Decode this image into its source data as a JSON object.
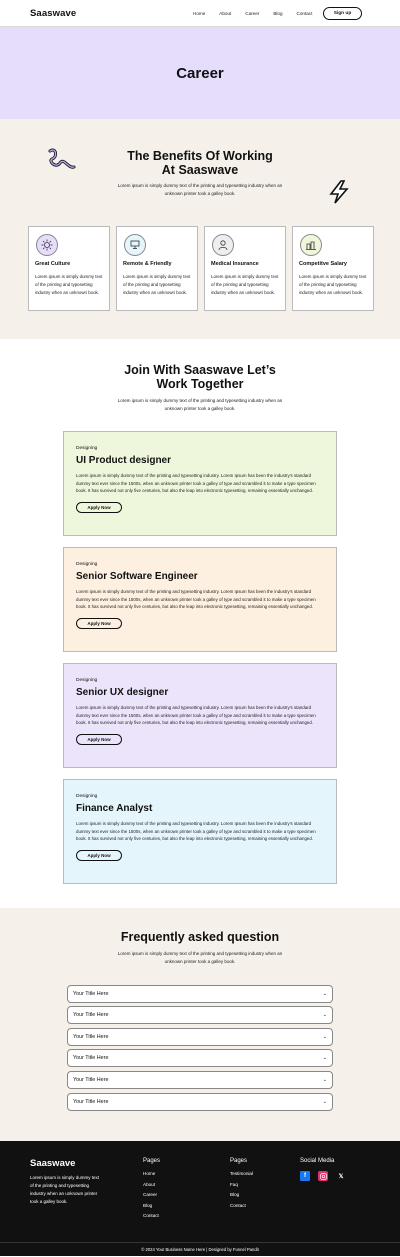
{
  "nav": {
    "brand": "Saaswave",
    "links": [
      "Home",
      "About",
      "Career",
      "Blog",
      "Contact"
    ],
    "signup": "Sign up"
  },
  "hero": {
    "title": "Career"
  },
  "benefits": {
    "title_line1": "The Benefits Of Working",
    "title_line2": "At Saaswave",
    "subtitle": "Lorem ipsum is simply dummy text of the printing and typesetting industry when an unknown printer took a galley book.",
    "cards": [
      {
        "icon": "culture-icon",
        "title": "Great Culture",
        "text": "Lorem ipsum is simply dummy text of the printing and typesetting industry when an unknown book."
      },
      {
        "icon": "remote-icon",
        "title": "Remote & Friendly",
        "text": "Lorem ipsum is simply dummy text of the printing and typesetting industry when an unknown book."
      },
      {
        "icon": "medical-icon",
        "title": "Medical Insurance",
        "text": "Lorem ipsum is simply dummy text of the printing and typesetting industry when an unknown book."
      },
      {
        "icon": "salary-icon",
        "title": "Competitve Salary",
        "text": "Lorem ipsum is simply dummy text of the printing and typesetting industry when an unknown book."
      }
    ]
  },
  "jobs": {
    "title_line1": "Join With Saaswave Let’s",
    "title_line2": "Work Together",
    "subtitle": "Lorem ipsum is simply dummy text of the printing and typesetting industry when an unknown printer took a galley book.",
    "items": [
      {
        "tag": "Designing",
        "title": "UI Product designer",
        "bg": "#eef7dc",
        "text": "Lorem ipsum is simply dummy text of the printing and typesetting industry. Lorem Ipsum has been the industry's standard dummy text ever since the 1500s, when an unknown printer took a galley of type and scrambled it to make a type specimen book. It has survived not only five centuries, but also the leap into electronic typesetting, remaining essentially unchanged.",
        "button": "Apply Now"
      },
      {
        "tag": "Designing",
        "title": "Senior Software Engineer",
        "bg": "#fdf0e1",
        "text": "Lorem ipsum is simply dummy text of the printing and typesetting industry. Lorem Ipsum has been the industry's standard dummy text ever since the 1500s, when an unknown printer took a galley of type and scrambled it to make a type specimen book. It has survived not only five centuries, but also the leap into electronic typesetting, remaining essentially unchanged.",
        "button": "Apply Now"
      },
      {
        "tag": "Designing",
        "title": "Senior UX designer",
        "bg": "#ece4fb",
        "text": "Lorem ipsum is simply dummy text of the printing and typesetting industry. Lorem Ipsum has been the industry's standard dummy text ever since the 1500s, when an unknown printer took a galley of type and scrambled it to make a type specimen book. It has survived not only five centuries, but also the leap into electronic typesetting, remaining essentially unchanged.",
        "button": "Apply Now"
      },
      {
        "tag": "Designing",
        "title": "Finance Analyst",
        "bg": "#e4f5fb",
        "text": "Lorem ipsum is simply dummy text of the printing and typesetting industry. Lorem Ipsum has been the industry's standard dummy text ever since the 1500s, when an unknown printer took a galley of type and scrambled it to make a type specimen book. It has survived not only five centuries, but also the leap into electronic typesetting, remaining essentially unchanged.",
        "button": "Apply Now"
      }
    ]
  },
  "faq": {
    "title": "Frequently asked question",
    "subtitle": "Lorem ipsum is simply dummy text of the printing and typesetting industry when an unknown printer took a galley book.",
    "items": [
      "Your Title Here",
      "Your Title Here",
      "Your Title Here",
      "Your Title Here",
      "Your Title Here",
      "Your Title Here"
    ]
  },
  "footer": {
    "brand": "Saaswave",
    "desc": "Lorem ipsum is simply dummy text of the printing and typesetting industry when an unknown printer took a galley book.",
    "col1_title": "Pages",
    "col1": [
      "Home",
      "About",
      "Career",
      "Blog",
      "Contact"
    ],
    "col2_title": "Pages",
    "col2": [
      "Testimonial",
      "Faq",
      "Blog",
      "Contact"
    ],
    "social_title": "Social Media",
    "social_icons": [
      "facebook-icon",
      "instagram-icon",
      "x-icon"
    ],
    "copyright": "© 2024 Your Business Name Here | Designed by Funnel Pandit"
  },
  "colors": {
    "hero_bg": "#e6dcfb",
    "section_bg": "#f5f1ea",
    "footer_bg": "#111111",
    "facebook": "#1877f2",
    "instagram": "#e1306c"
  }
}
